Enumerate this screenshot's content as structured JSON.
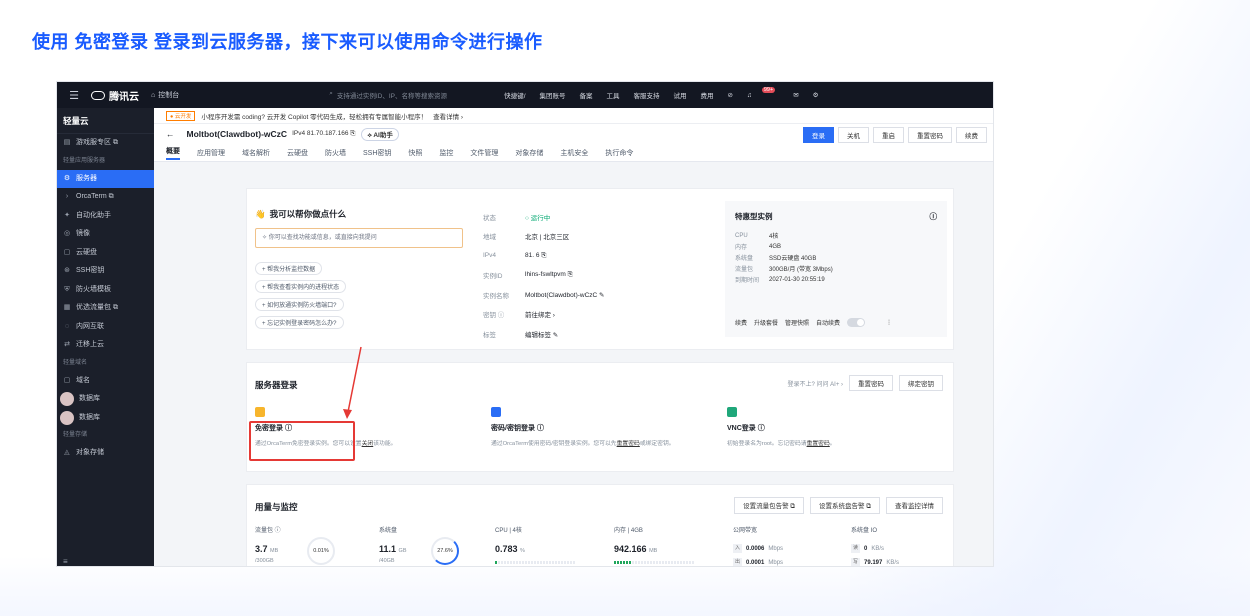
{
  "heading": "使用 免密登录 登录到云服务器，接下来可以使用命令进行操作",
  "topbar": {
    "brand": "腾讯云",
    "console": "控制台",
    "search_placeholder": "支持通过实例ID、IP、名称等搜索资源",
    "nav": [
      "快捷键/",
      "集团账号",
      "备案",
      "工具",
      "客服支持",
      "试用",
      "费用"
    ],
    "badge": "99+"
  },
  "sidebar": {
    "title": "轻量云",
    "items": [
      {
        "icon": "▤",
        "label": "游戏服专区 ⧉",
        "type": "item"
      },
      {
        "label": "轻量应用服务器",
        "type": "section"
      },
      {
        "icon": "⚙",
        "label": "服务器",
        "type": "item",
        "active": true
      },
      {
        "icon": "›",
        "label": "OrcaTerm ⧉",
        "type": "item"
      },
      {
        "icon": "✦",
        "label": "自动化助手",
        "type": "item"
      },
      {
        "icon": "◎",
        "label": "镜像",
        "type": "item"
      },
      {
        "icon": "▢",
        "label": "云硬盘",
        "type": "item"
      },
      {
        "icon": "⊛",
        "label": "SSH密钥",
        "type": "item"
      },
      {
        "icon": "⛨",
        "label": "防火墙模板",
        "type": "item"
      },
      {
        "icon": "▦",
        "label": "优选流量包 ⧉",
        "type": "item"
      },
      {
        "icon": "◌",
        "label": "内网互联",
        "type": "item"
      },
      {
        "icon": "⇄",
        "label": "迁移上云",
        "type": "item"
      },
      {
        "label": "轻量域名",
        "type": "section"
      },
      {
        "icon": "▢",
        "label": "域名",
        "type": "item"
      },
      {
        "label": "数据库",
        "type": "avatar-item"
      },
      {
        "label": "数据库",
        "type": "avatar-item"
      },
      {
        "label": "轻量存储",
        "type": "section"
      },
      {
        "icon": "◬",
        "label": "对象存储",
        "type": "item"
      }
    ]
  },
  "notice": {
    "tag": "● 云开发",
    "text": "小程序开发需 coding? 云开发 Copilot 零代码生成，轻松拥有专属智能小程序！",
    "link": "查看详情 ›"
  },
  "instance": {
    "back": "←",
    "name": "Moltbot(Clawdbot)-wCzC",
    "ip_label": "IPv4  81.70.187.166  ⎘",
    "ai_btn": "⟡ AI助手",
    "actions": [
      "登录",
      "关机",
      "重启",
      "重置密码",
      "续费"
    ]
  },
  "tabs": [
    "概要",
    "应用管理",
    "域名解析",
    "云硬盘",
    "防火墙",
    "SSH密钥",
    "快照",
    "监控",
    "文件管理",
    "对象存储",
    "主机安全",
    "执行命令"
  ],
  "assistant": {
    "title": "我可以帮你做点什么",
    "emoji": "👋",
    "placeholder": "✧  你可以查找功能或信息，或直接向我提问",
    "suggestions": [
      "+ 帮我分析监控数据",
      "+ 帮我查看实例内的进程状态",
      "+ 如何放通实例防火墙端口?",
      "+ 忘记实例登录密码怎么办?"
    ]
  },
  "info": [
    {
      "k": "状态",
      "v": "○ 运行中"
    },
    {
      "k": "地域",
      "v": "北京 | 北京三区"
    },
    {
      "k": "IPv4",
      "v": "81.          6 ⎘"
    },
    {
      "k": "实例ID",
      "v": "lhins-fswltpvm ⎘"
    },
    {
      "k": "实例名称",
      "v": "Moltbot(Clawdbot)-wCzC ✎"
    },
    {
      "k": "密钥 ⓘ",
      "v": "前往绑定 ›"
    },
    {
      "k": "标签",
      "v": "编辑标签 ✎"
    }
  ],
  "spec": {
    "title": "特惠型实例",
    "rows": [
      {
        "k": "CPU",
        "v": "4核"
      },
      {
        "k": "内存",
        "v": "4GB"
      },
      {
        "k": "系统盘",
        "v": "SSD云硬盘 40GB"
      },
      {
        "k": "流量包",
        "v": "300GB/月 (带宽 3Mbps)"
      },
      {
        "k": "到期时间",
        "v": "2027-01-30 20:55:19"
      }
    ],
    "links": [
      "续费",
      "升级套餐",
      "管理快照",
      "自动续费"
    ]
  },
  "login": {
    "title": "服务器登录",
    "hint": "登录不上? 问问 AI+ ›",
    "buttons": [
      "重置密码",
      "绑定密钥"
    ],
    "methods": [
      {
        "title": "免密登录 ⓘ",
        "desc": "通过OrcaTerm免密登录实例。您可以设置",
        "link": "关闭",
        "desc2": "该功能。",
        "color": "#f7b52c"
      },
      {
        "title": "密码/密钥登录 ⓘ",
        "desc": "通过OrcaTerm使用密码/密钥登录实例。您可以先",
        "link": "重置密码",
        "desc2": "或绑定密钥。",
        "color": "#2a6df5"
      },
      {
        "title": "VNC登录 ⓘ",
        "desc": "初始登录名为root。忘记密码请",
        "link": "重置密码",
        "desc2": "。",
        "color": "#1fa77a"
      }
    ]
  },
  "usage": {
    "title": "用量与监控",
    "buttons": [
      "设置流量包告警 ⧉",
      "设置系统盘告警 ⧉",
      "查看监控详情"
    ],
    "traffic": {
      "label": "流量包 ⓘ",
      "value": "3.7",
      "unit": "MB",
      "sub": "/300GB",
      "ring": "0.01%"
    },
    "disk": {
      "label": "系统盘",
      "value": "11.1",
      "unit": "GB",
      "sub": "/40GB",
      "ring": "27.6%"
    },
    "cpu": {
      "label": "CPU | 4核",
      "value": "0.783",
      "unit": "%",
      "fill": 0.02
    },
    "mem": {
      "label": "内存 | 4GB",
      "value": "942.166",
      "unit": "MB",
      "fill": 0.23
    },
    "net": {
      "label": "公网带宽",
      "in": "0.0006",
      "out": "0.0001",
      "unit": "Mbps",
      "in_icon": "入",
      "out_icon": "出"
    },
    "io": {
      "label": "系统盘 IO",
      "read": "0",
      "write": "79.197",
      "unit": "KB/s",
      "read_icon": "读",
      "write_icon": "写"
    }
  },
  "bottom_icon": "≡"
}
